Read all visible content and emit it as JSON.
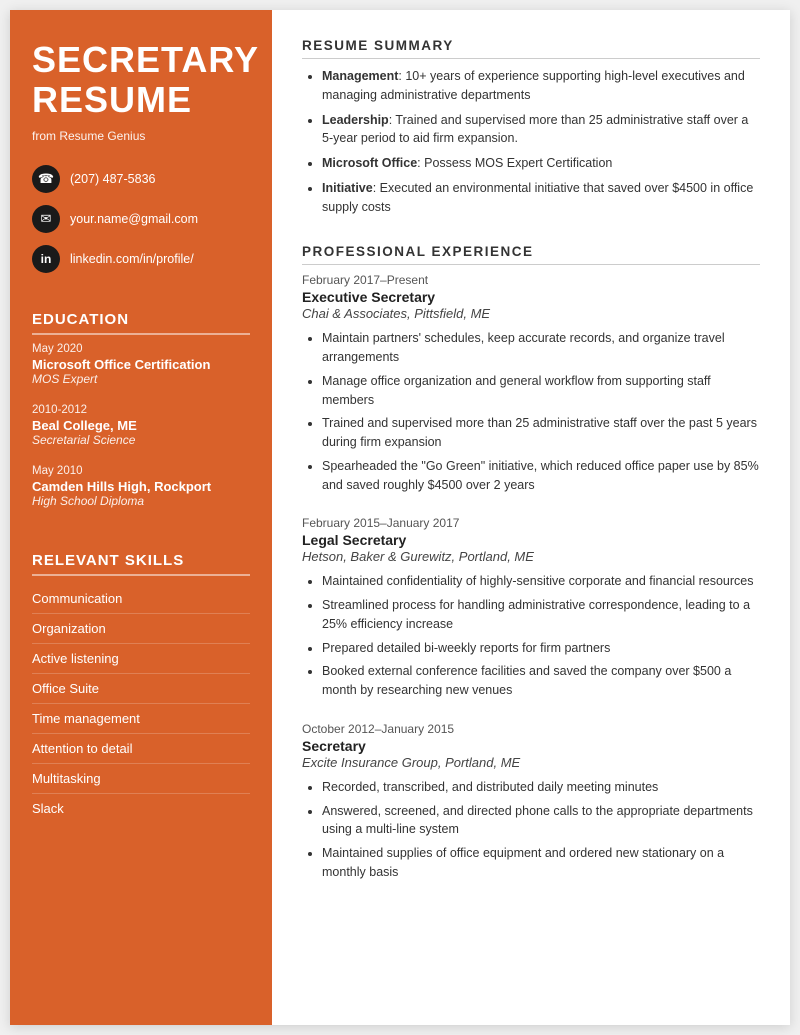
{
  "sidebar": {
    "title": "SECRETARY\nRESUME",
    "title_line1": "SECRETARY",
    "title_line2": "RESUME",
    "from": "from Resume Genius",
    "contact": {
      "phone": "(207) 487-5836",
      "email": "your.name@gmail.com",
      "linkedin": "linkedin.com/in/profile/"
    },
    "education_title": "EDUCATION",
    "education": [
      {
        "date": "May 2020",
        "name": "Microsoft Office Certification",
        "detail": "MOS Expert"
      },
      {
        "date": "2010-2012",
        "name": "Beal College, ME",
        "detail": "Secretarial Science"
      },
      {
        "date": "May 2010",
        "name": "Camden Hills High, Rockport",
        "detail": "High School Diploma"
      }
    ],
    "skills_title": "RELEVANT SKILLS",
    "skills": [
      "Communication",
      "Organization",
      "Active listening",
      "Office Suite",
      "Time management",
      "Attention to detail",
      "Multitasking",
      "Slack"
    ]
  },
  "main": {
    "summary_title": "RESUME SUMMARY",
    "summary_items": [
      {
        "bold": "Management",
        "text": ": 10+ years of experience supporting high-level executives and managing administrative departments"
      },
      {
        "bold": "Leadership",
        "text": ": Trained and supervised more than 25 administrative staff over a 5-year period to aid firm expansion."
      },
      {
        "bold": "Microsoft Office",
        "text": ": Possess MOS Expert Certification"
      },
      {
        "bold": "Initiative",
        "text": ": Executed an environmental initiative that saved over $4500 in office supply costs"
      }
    ],
    "experience_title": "PROFESSIONAL EXPERIENCE",
    "jobs": [
      {
        "date": "February 2017–Present",
        "title": "Executive Secretary",
        "company": "Chai & Associates, Pittsfield, ME",
        "bullets": [
          "Maintain partners' schedules, keep accurate records, and organize travel arrangements",
          "Manage office organization and general workflow from supporting staff members",
          "Trained and supervised more than 25 administrative staff over the past 5 years during firm expansion",
          "Spearheaded the \"Go Green\" initiative, which reduced office paper use by 85% and saved roughly $4500 over 2 years"
        ]
      },
      {
        "date": "February 2015–January 2017",
        "title": "Legal Secretary",
        "company": "Hetson, Baker & Gurewitz, Portland, ME",
        "bullets": [
          "Maintained confidentiality of highly-sensitive corporate and financial resources",
          "Streamlined process for handling administrative correspondence, leading to a 25% efficiency increase",
          "Prepared detailed bi-weekly reports for firm partners",
          "Booked external conference facilities and saved the company over $500 a month by researching new venues"
        ]
      },
      {
        "date": "October 2012–January 2015",
        "title": "Secretary",
        "company": "Excite Insurance Group, Portland, ME",
        "bullets": [
          "Recorded, transcribed, and distributed daily meeting minutes",
          "Answered, screened, and directed phone calls to the appropriate departments using a multi-line system",
          "Maintained supplies of office equipment and ordered new stationary on a monthly basis"
        ]
      }
    ]
  }
}
